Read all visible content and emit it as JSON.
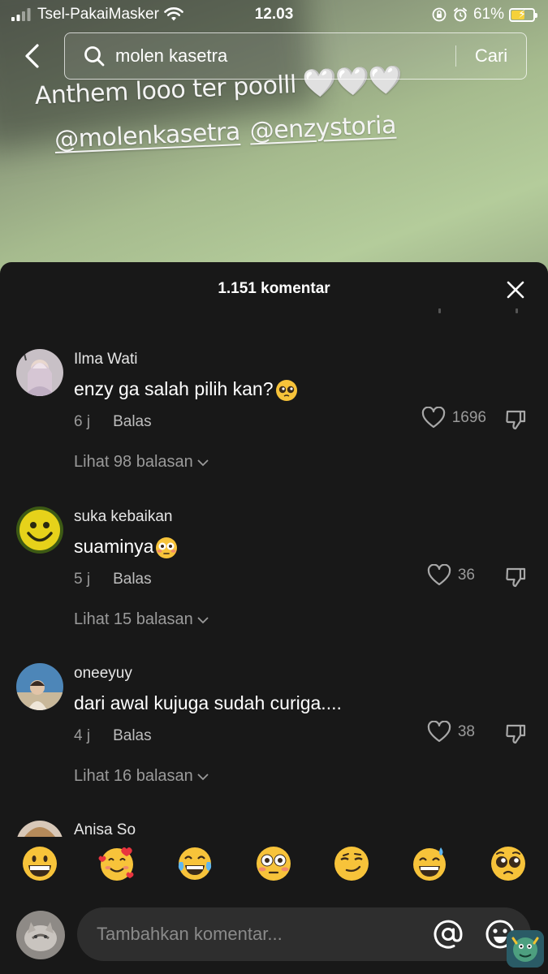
{
  "status_bar": {
    "carrier": "Tsel-PakaiMasker",
    "time": "12.03",
    "battery_percent": "61%",
    "battery_level": 0.61
  },
  "search": {
    "query": "molen kasetra",
    "submit_label": "Cari"
  },
  "video": {
    "caption_line1": "Anthem looo ter poolll",
    "caption_hearts": "🤍🤍🤍",
    "mention_1": "@molenkasetra",
    "mention_2": "@enzystoria"
  },
  "comments_panel": {
    "title": "1.151 komentar",
    "comments": [
      {
        "username": "Ilma Wati",
        "text": "enzy ga salah pilih kan?",
        "emoji": "pleading-face",
        "age": "6 j",
        "reply_label": "Balas",
        "likes": "1696",
        "view_replies": "Lihat 98 balasan"
      },
      {
        "username": "suka kebaikan",
        "text": "suaminya",
        "emoji": "flushed-face",
        "age": "5 j",
        "reply_label": "Balas",
        "likes": "36",
        "view_replies": "Lihat 15 balasan"
      },
      {
        "username": "oneeyuy",
        "text": "dari awal kujuga sudah curiga....",
        "age": "4 j",
        "reply_label": "Balas",
        "likes": "38",
        "view_replies": "Lihat 16 balasan"
      },
      {
        "username": "Anisa So"
      }
    ]
  },
  "emoji_bar": [
    "grinning-face",
    "smiling-face-with-hearts",
    "tears-of-joy",
    "flushed-face",
    "smirking-face",
    "grinning-sweat",
    "pleading-face"
  ],
  "input": {
    "placeholder": "Tambahkan komentar..."
  },
  "colors": {
    "sheet_bg": "#181818",
    "input_bg": "#2e2e2e",
    "muted_text": "#9a9a9a",
    "emoji_yellow": "#f7c33a"
  }
}
